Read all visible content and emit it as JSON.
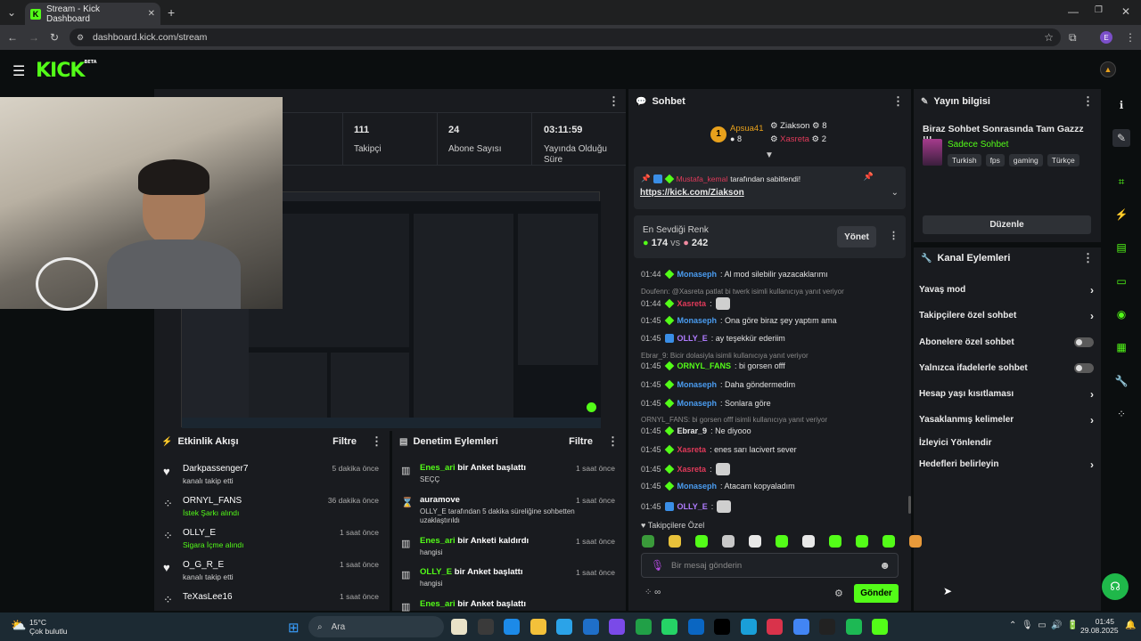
{
  "browser": {
    "tab_title": "Stream - Kick Dashboard",
    "url": "dashboard.kick.com/stream",
    "profile": "E"
  },
  "header": {
    "logo": "KICK",
    "logo_beta": "BETA"
  },
  "stats": [
    {
      "value": "111",
      "label": "Takipçi"
    },
    {
      "value": "24",
      "label": "Abone Sayısı"
    },
    {
      "value": "03:11:59",
      "label": "Yayında Olduğu Süre"
    }
  ],
  "feed": {
    "title": "Etkinlik Akışı",
    "filter": "Filtre",
    "items": [
      {
        "name": "Darkpassenger7",
        "time": "5 dakika önce",
        "desc": "kanalı takip etti",
        "icon": "heart-icon"
      },
      {
        "name": "ORNYL_FANS",
        "time": "36 dakika önce",
        "desc": "İstek Şarkı alındı",
        "icon": "points-icon"
      },
      {
        "name": "OLLY_E",
        "time": "1 saat önce",
        "desc": "Sigara İçme alındı",
        "icon": "points-icon"
      },
      {
        "name": "O_G_R_E",
        "time": "1 saat önce",
        "desc": "kanalı takip etti",
        "icon": "heart-icon"
      },
      {
        "name": "TeXasLee16",
        "time": "1 saat önce",
        "desc": "",
        "icon": "points-icon"
      }
    ]
  },
  "modlog": {
    "title": "Denetim Eylemleri",
    "filter": "Filtre",
    "items": [
      {
        "actor": "Enes_ari",
        "action": " bir Anket başlattı",
        "time": "1 saat önce",
        "sub": "SEÇÇ"
      },
      {
        "actor": "auramove",
        "action": "",
        "time": "1 saat önce",
        "sub": "OLLY_E tarafından 5 dakika süreliğine sohbetten uzaklaştırıldı"
      },
      {
        "actor": "Enes_ari",
        "action": " bir Anketi kaldırdı",
        "time": "1 saat önce",
        "sub": "hangisi"
      },
      {
        "actor": "OLLY_E",
        "action": " bir Anket başlattı",
        "time": "1 saat önce",
        "sub": "hangisi"
      },
      {
        "actor": "Enes_ari",
        "action": " bir Anket başlattı",
        "time": "",
        "sub": ""
      }
    ]
  },
  "chat": {
    "title": "Sohbet",
    "leaders": [
      {
        "rank": "1",
        "name": "Apsua41",
        "count": "8"
      },
      {
        "name": "Ziakson",
        "count": "8"
      },
      {
        "name": "Xasreta",
        "count": "2"
      }
    ],
    "pinned": {
      "user": "Mustafa_kemal",
      "text": " tarafından sabitlendi!",
      "link": "https://kick.com/Ziakson"
    },
    "poll": {
      "title": "En Sevdiği Renk",
      "a": "174",
      "vs": "vs",
      "b": "242",
      "manage": "Yönet"
    },
    "messages": [
      {
        "type": "msg",
        "time": "01:44",
        "user": "Monaseph",
        "color": "#4a9cf0",
        "text": ": Al mod silebilir yazacaklarımı"
      },
      {
        "type": "reply",
        "text": "Doufenn: @Xasreta patlat bi twerk isimli kullanıcıya yanıt veriyor"
      },
      {
        "type": "msg",
        "time": "01:44",
        "user": "Xasreta",
        "color": "#e03a5a",
        "text": ":"
      },
      {
        "type": "msg",
        "time": "01:45",
        "user": "Monaseph",
        "color": "#4a9cf0",
        "text": ": Ona göre biraz şey yaptım ama"
      },
      {
        "type": "msg",
        "time": "01:45",
        "user": "OLLY_E",
        "color": "#b07cff",
        "text": ": ay teşekkür ederiim"
      },
      {
        "type": "reply",
        "text": "Ebrar_9: Bicir dolasiyla isimli kullanıcıya yanıt veriyor"
      },
      {
        "type": "msg",
        "time": "01:45",
        "user": "ORNYL_FANS",
        "color": "#53fc18",
        "text": ": bi gorsen offf"
      },
      {
        "type": "msg",
        "time": "01:45",
        "user": "Monaseph",
        "color": "#4a9cf0",
        "text": ": Daha göndermedim"
      },
      {
        "type": "msg",
        "time": "01:45",
        "user": "Monaseph",
        "color": "#4a9cf0",
        "text": ": Sonlara göre"
      },
      {
        "type": "reply",
        "text": "ORNYL_FANS: bi gorsen offf isimli kullanıcıya yanıt veriyor"
      },
      {
        "type": "msg",
        "time": "01:45",
        "user": "Ebrar_9",
        "color": "#e8e8e8",
        "text": ": Ne diyooo"
      },
      {
        "type": "msg",
        "time": "01:45",
        "user": "Xasreta",
        "color": "#e03a5a",
        "text": ": enes sarı lacivert sever"
      },
      {
        "type": "msg",
        "time": "01:45",
        "user": "Xasreta",
        "color": "#e03a5a",
        "text": ":"
      },
      {
        "type": "msg",
        "time": "01:45",
        "user": "Monaseph",
        "color": "#4a9cf0",
        "text": ": Atacam kopyaladım"
      },
      {
        "type": "msg",
        "time": "01:45",
        "user": "OLLY_E",
        "color": "#b07cff",
        "text": ":"
      }
    ],
    "followers_only": "Takipçilere Özel",
    "input_placeholder": "Bir mesaj gönderin",
    "send": "Gönder"
  },
  "info": {
    "title": "Yayın bilgisi",
    "stream_title": "Biraz Sohbet Sonrasında Tam Gazzz !!!",
    "category": "Sadece Sohbet",
    "tags": [
      "Turkish",
      "fps",
      "gaming",
      "Türkçe"
    ],
    "edit": "Düzenle"
  },
  "actions": {
    "title": "Kanal Eylemleri",
    "items": [
      {
        "label": "Yavaş mod",
        "kind": "arrow"
      },
      {
        "label": "Takipçilere özel sohbet",
        "kind": "arrow"
      },
      {
        "label": "Abonelere özel sohbet",
        "kind": "toggle"
      },
      {
        "label": "Yalnızca ifadelerle sohbet",
        "kind": "toggle"
      },
      {
        "label": "Hesap yaşı kısıtlaması",
        "kind": "arrow"
      },
      {
        "label": "Yasaklanmış kelimeler",
        "kind": "arrow"
      },
      {
        "label": "İzleyici Yönlendir",
        "kind": "none"
      },
      {
        "label": "Hedefleri belirleyin",
        "kind": "arrow"
      }
    ]
  },
  "taskbar": {
    "temp": "15°C",
    "weather": "Çok bulutlu",
    "search": "Ara",
    "time": "01:45",
    "date": "29.08.2025"
  },
  "colors": {
    "accent": "#53fc18",
    "panel": "#191b1f",
    "bg": "#0b0e0f"
  }
}
